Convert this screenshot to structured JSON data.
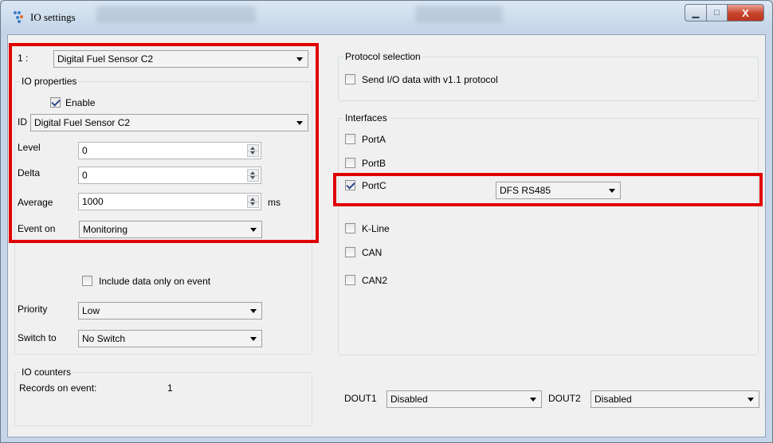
{
  "window": {
    "title": "IO settings",
    "minimize_label": "▁",
    "maximize_label": "□",
    "close_label": "X"
  },
  "io_selector": {
    "index": "1 :",
    "value": "Digital Fuel Sensor C2"
  },
  "io_properties": {
    "title": "IO properties",
    "enable_label": "Enable",
    "enable_checked": true,
    "id_label": "ID",
    "id_value": "Digital Fuel Sensor C2",
    "level_label": "Level",
    "level_value": "0",
    "delta_label": "Delta",
    "delta_value": "0",
    "average_label": "Average",
    "average_value": "1000",
    "average_unit": "ms",
    "event_label": "Event on",
    "event_value": "Monitoring",
    "include_label": "Include data only on event",
    "priority_label": "Priority",
    "priority_value": "Low",
    "switch_label": "Switch to",
    "switch_value": "No Switch"
  },
  "io_counters": {
    "title": "IO counters",
    "records_label": "Records on event:",
    "records_value": "1"
  },
  "protocol": {
    "title": "Protocol selection",
    "send_label": "Send I/O data with v1.1 protocol"
  },
  "interfaces": {
    "title": "Interfaces",
    "items": [
      {
        "label": "PortA",
        "checked": false
      },
      {
        "label": "PortB",
        "checked": false
      },
      {
        "label": "PortC",
        "checked": true
      },
      {
        "label": "K-Line",
        "checked": false
      },
      {
        "label": "CAN",
        "checked": false
      },
      {
        "label": "CAN2",
        "checked": false
      }
    ],
    "portc_mode": "DFS RS485"
  },
  "dout": {
    "dout1_label": "DOUT1",
    "dout1_value": "Disabled",
    "dout2_label": "DOUT2",
    "dout2_value": "Disabled"
  },
  "colors": {
    "highlight": "#e10000",
    "window_frame": "#c6d6e8",
    "close_button": "#c7432c"
  }
}
